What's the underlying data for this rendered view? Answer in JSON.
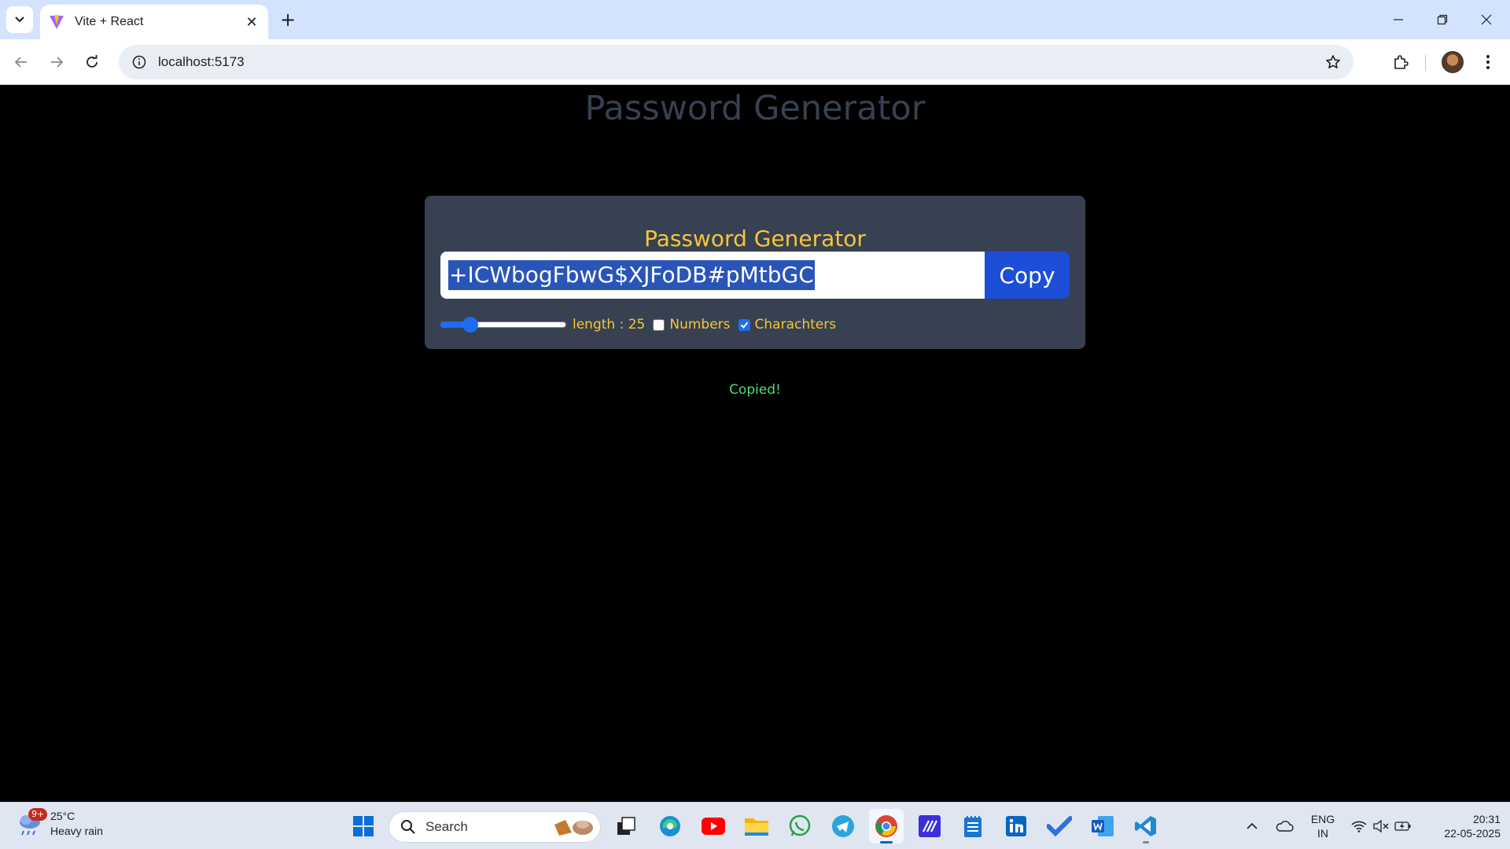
{
  "browser": {
    "tab_title": "Vite + React",
    "url": "localhost:5173"
  },
  "page": {
    "heading": "Password Generator",
    "card_title": "Password Generator",
    "password": "+ICWbogFbwG$XJFoDB#pMtbGC",
    "copy_label": "Copy",
    "length_label": "length : 25",
    "length_value": 25,
    "length_min": 6,
    "length_max": 100,
    "numbers_label": "Numbers",
    "numbers_checked": false,
    "chars_label": "Charachters",
    "chars_checked": true,
    "status_text": "Copied!"
  },
  "taskbar": {
    "weather_badge": "9+",
    "temperature": "25°C",
    "condition": "Heavy rain",
    "search_label": "Search",
    "lang_line1": "ENG",
    "lang_line2": "IN",
    "time": "20:31",
    "date": "22-05-2025"
  },
  "colors": {
    "card_bg": "#374151",
    "accent_yellow": "#f8c53a",
    "copy_button": "#1d4ed8",
    "status_green": "#4ade80"
  }
}
